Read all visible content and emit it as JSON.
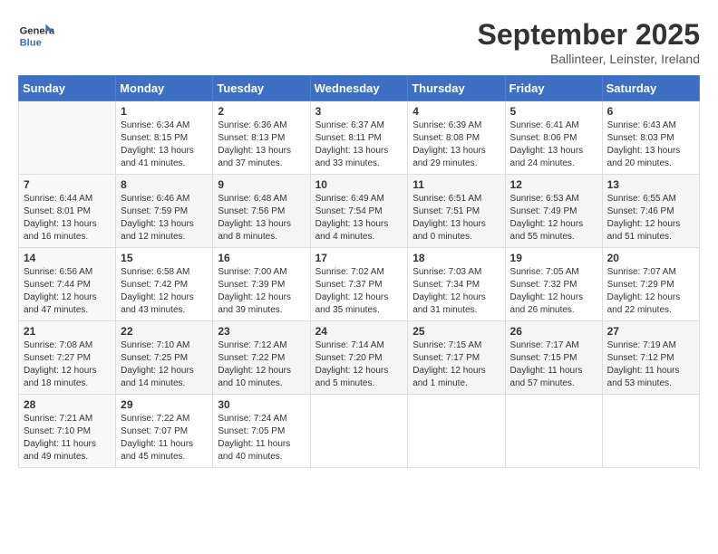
{
  "header": {
    "logo_line1": "General",
    "logo_line2": "Blue",
    "month": "September 2025",
    "location": "Ballinteer, Leinster, Ireland"
  },
  "days_of_week": [
    "Sunday",
    "Monday",
    "Tuesday",
    "Wednesday",
    "Thursday",
    "Friday",
    "Saturday"
  ],
  "weeks": [
    [
      {
        "day": "",
        "info": ""
      },
      {
        "day": "1",
        "info": "Sunrise: 6:34 AM\nSunset: 8:15 PM\nDaylight: 13 hours\nand 41 minutes."
      },
      {
        "day": "2",
        "info": "Sunrise: 6:36 AM\nSunset: 8:13 PM\nDaylight: 13 hours\nand 37 minutes."
      },
      {
        "day": "3",
        "info": "Sunrise: 6:37 AM\nSunset: 8:11 PM\nDaylight: 13 hours\nand 33 minutes."
      },
      {
        "day": "4",
        "info": "Sunrise: 6:39 AM\nSunset: 8:08 PM\nDaylight: 13 hours\nand 29 minutes."
      },
      {
        "day": "5",
        "info": "Sunrise: 6:41 AM\nSunset: 8:06 PM\nDaylight: 13 hours\nand 24 minutes."
      },
      {
        "day": "6",
        "info": "Sunrise: 6:43 AM\nSunset: 8:03 PM\nDaylight: 13 hours\nand 20 minutes."
      }
    ],
    [
      {
        "day": "7",
        "info": "Sunrise: 6:44 AM\nSunset: 8:01 PM\nDaylight: 13 hours\nand 16 minutes."
      },
      {
        "day": "8",
        "info": "Sunrise: 6:46 AM\nSunset: 7:59 PM\nDaylight: 13 hours\nand 12 minutes."
      },
      {
        "day": "9",
        "info": "Sunrise: 6:48 AM\nSunset: 7:56 PM\nDaylight: 13 hours\nand 8 minutes."
      },
      {
        "day": "10",
        "info": "Sunrise: 6:49 AM\nSunset: 7:54 PM\nDaylight: 13 hours\nand 4 minutes."
      },
      {
        "day": "11",
        "info": "Sunrise: 6:51 AM\nSunset: 7:51 PM\nDaylight: 13 hours\nand 0 minutes."
      },
      {
        "day": "12",
        "info": "Sunrise: 6:53 AM\nSunset: 7:49 PM\nDaylight: 12 hours\nand 55 minutes."
      },
      {
        "day": "13",
        "info": "Sunrise: 6:55 AM\nSunset: 7:46 PM\nDaylight: 12 hours\nand 51 minutes."
      }
    ],
    [
      {
        "day": "14",
        "info": "Sunrise: 6:56 AM\nSunset: 7:44 PM\nDaylight: 12 hours\nand 47 minutes."
      },
      {
        "day": "15",
        "info": "Sunrise: 6:58 AM\nSunset: 7:42 PM\nDaylight: 12 hours\nand 43 minutes."
      },
      {
        "day": "16",
        "info": "Sunrise: 7:00 AM\nSunset: 7:39 PM\nDaylight: 12 hours\nand 39 minutes."
      },
      {
        "day": "17",
        "info": "Sunrise: 7:02 AM\nSunset: 7:37 PM\nDaylight: 12 hours\nand 35 minutes."
      },
      {
        "day": "18",
        "info": "Sunrise: 7:03 AM\nSunset: 7:34 PM\nDaylight: 12 hours\nand 31 minutes."
      },
      {
        "day": "19",
        "info": "Sunrise: 7:05 AM\nSunset: 7:32 PM\nDaylight: 12 hours\nand 26 minutes."
      },
      {
        "day": "20",
        "info": "Sunrise: 7:07 AM\nSunset: 7:29 PM\nDaylight: 12 hours\nand 22 minutes."
      }
    ],
    [
      {
        "day": "21",
        "info": "Sunrise: 7:08 AM\nSunset: 7:27 PM\nDaylight: 12 hours\nand 18 minutes."
      },
      {
        "day": "22",
        "info": "Sunrise: 7:10 AM\nSunset: 7:25 PM\nDaylight: 12 hours\nand 14 minutes."
      },
      {
        "day": "23",
        "info": "Sunrise: 7:12 AM\nSunset: 7:22 PM\nDaylight: 12 hours\nand 10 minutes."
      },
      {
        "day": "24",
        "info": "Sunrise: 7:14 AM\nSunset: 7:20 PM\nDaylight: 12 hours\nand 5 minutes."
      },
      {
        "day": "25",
        "info": "Sunrise: 7:15 AM\nSunset: 7:17 PM\nDaylight: 12 hours\nand 1 minute."
      },
      {
        "day": "26",
        "info": "Sunrise: 7:17 AM\nSunset: 7:15 PM\nDaylight: 11 hours\nand 57 minutes."
      },
      {
        "day": "27",
        "info": "Sunrise: 7:19 AM\nSunset: 7:12 PM\nDaylight: 11 hours\nand 53 minutes."
      }
    ],
    [
      {
        "day": "28",
        "info": "Sunrise: 7:21 AM\nSunset: 7:10 PM\nDaylight: 11 hours\nand 49 minutes."
      },
      {
        "day": "29",
        "info": "Sunrise: 7:22 AM\nSunset: 7:07 PM\nDaylight: 11 hours\nand 45 minutes."
      },
      {
        "day": "30",
        "info": "Sunrise: 7:24 AM\nSunset: 7:05 PM\nDaylight: 11 hours\nand 40 minutes."
      },
      {
        "day": "",
        "info": ""
      },
      {
        "day": "",
        "info": ""
      },
      {
        "day": "",
        "info": ""
      },
      {
        "day": "",
        "info": ""
      }
    ]
  ]
}
